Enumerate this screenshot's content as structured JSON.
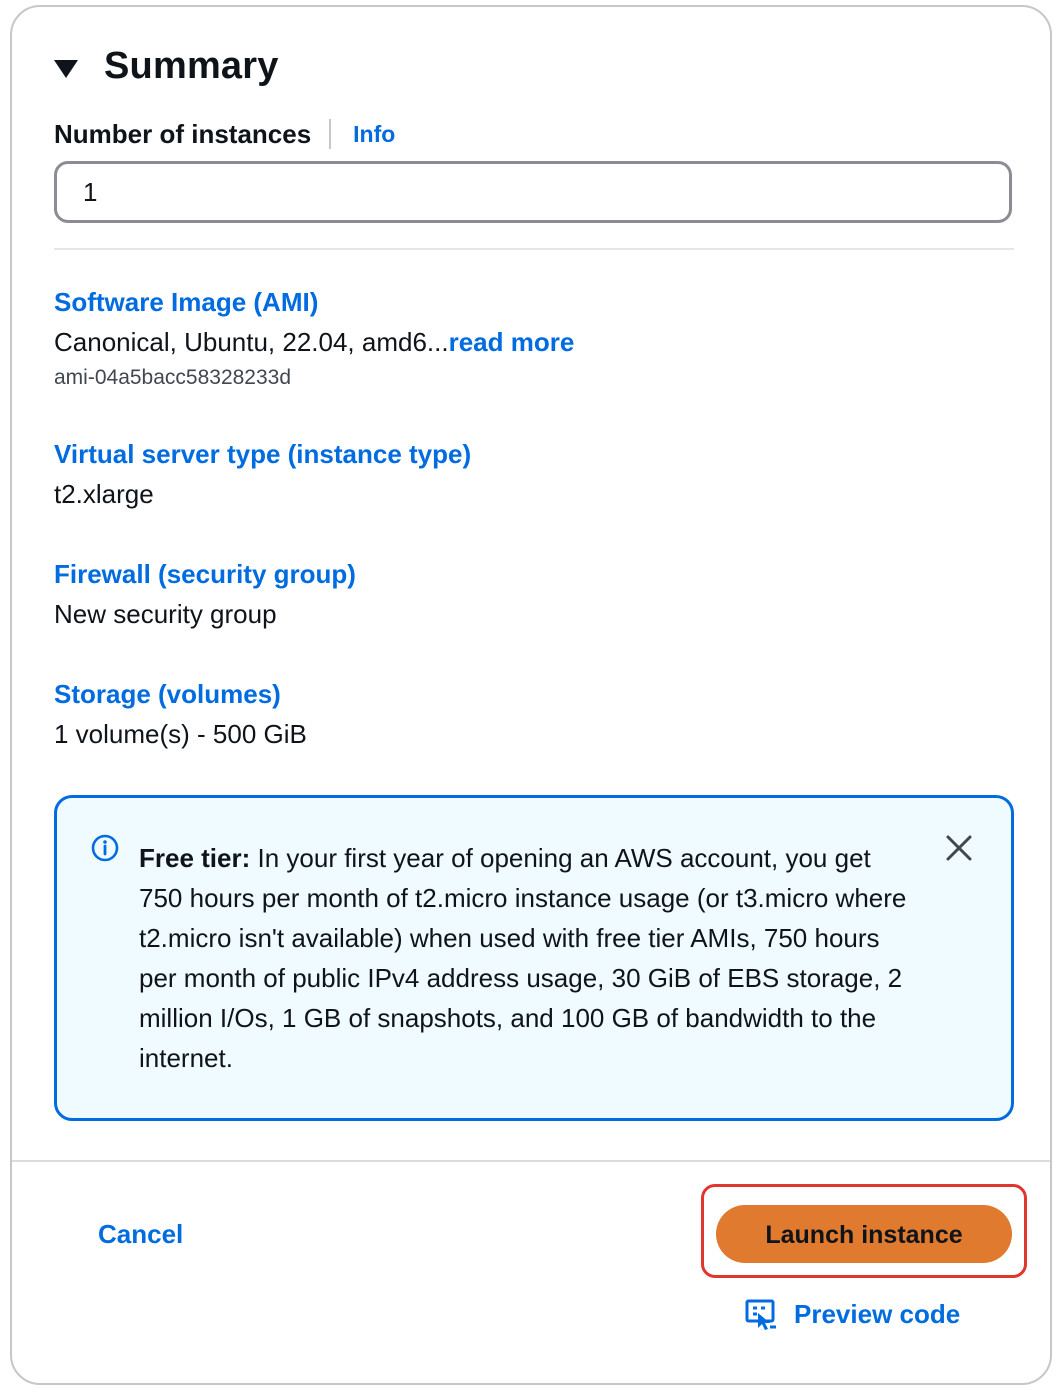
{
  "summary": {
    "title": "Summary"
  },
  "instances": {
    "label": "Number of instances",
    "info_label": "Info",
    "value": "1"
  },
  "ami": {
    "label": "Software Image (AMI)",
    "value": "Canonical, Ubuntu, 22.04, amd6...",
    "read_more": "read more",
    "id": "ami-04a5bacc58328233d"
  },
  "instance_type": {
    "label": "Virtual server type (instance type)",
    "value": "t2.xlarge"
  },
  "firewall": {
    "label": "Firewall (security group)",
    "value": "New security group"
  },
  "storage": {
    "label": "Storage (volumes)",
    "value": "1 volume(s) - 500 GiB"
  },
  "free_tier": {
    "heading": "Free tier:",
    "body": " In your first year of opening an AWS account, you get 750 hours per month of t2.micro instance usage (or t3.micro where t2.micro isn't available) when used with free tier AMIs, 750 hours per month of public IPv4 address usage, 30 GiB of EBS storage, 2 million I/Os, 1 GB of snapshots, and 100 GB of bandwidth to the internet."
  },
  "actions": {
    "cancel_label": "Cancel",
    "launch_label": "Launch instance",
    "preview_label": "Preview code"
  },
  "colors": {
    "link": "#006ce0",
    "primary_button": "#e07a2e",
    "highlight_outline": "#e0362d",
    "info_bg": "#f0fbff"
  },
  "icons": {
    "collapse": "caret-down-icon",
    "info": "info-circle-icon",
    "close": "close-icon",
    "preview": "preview-code-icon"
  }
}
